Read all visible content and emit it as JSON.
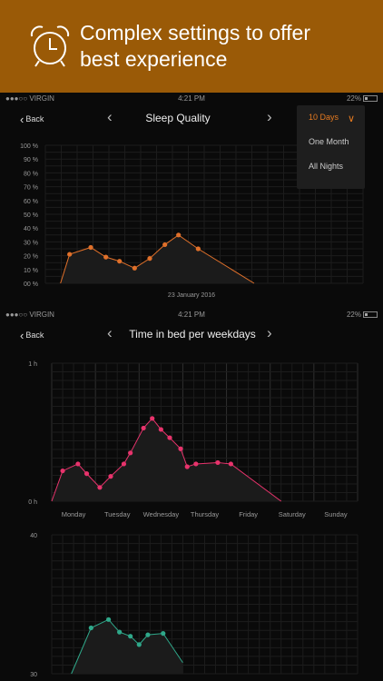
{
  "banner": {
    "line1": "Complex settings to offer",
    "line2": "best experience"
  },
  "status": {
    "carrier": "●●●○○ VIRGIN",
    "time": "4:21 PM",
    "battery": "22%"
  },
  "screen1": {
    "back_label": "Back",
    "title": "Sleep Quality",
    "dropdown": {
      "selected": "10 Days",
      "options": [
        "One Month",
        "All Nights"
      ]
    },
    "chart_data": {
      "type": "area",
      "title": "Sleep Quality",
      "xlabel": "23 January 2016",
      "y_ticks": [
        "100 %",
        "90 %",
        "80 %",
        "70 %",
        "60 %",
        "50 %",
        "40 %",
        "30 %",
        "20 %",
        "10 %",
        "00 %"
      ],
      "ylim": [
        0,
        100
      ],
      "x": [
        1,
        1.6,
        3,
        4,
        4.9,
        5.9,
        6.9,
        7.9,
        8.8,
        10.1,
        13.8
      ],
      "values": [
        0,
        21,
        26,
        19,
        16,
        11,
        18,
        28,
        35,
        25,
        0
      ],
      "xlim": [
        0,
        21
      ],
      "color": "#e0702a",
      "grid": true
    }
  },
  "screen2": {
    "back_label": "Back",
    "title": "Time in bed per weekdays",
    "chart_data": {
      "type": "area",
      "title": "Time in bed per weekdays",
      "categories": [
        "Monday",
        "Tuesday",
        "Wednesday",
        "Thursday",
        "Friday",
        "Saturday",
        "Sunday"
      ],
      "y_ticks": [
        "1 h",
        "0 h"
      ],
      "ylim": [
        0,
        1
      ],
      "x": [
        -0.5,
        -0.25,
        0.1,
        0.3,
        0.6,
        0.85,
        1.15,
        1.3,
        1.6,
        1.8,
        2.0,
        2.2,
        2.45,
        2.6,
        2.8,
        3.3,
        3.6,
        4.75
      ],
      "values": [
        0,
        0.22,
        0.27,
        0.2,
        0.1,
        0.18,
        0.27,
        0.35,
        0.53,
        0.6,
        0.52,
        0.46,
        0.38,
        0.25,
        0.27,
        0.28,
        0.27,
        0
      ],
      "color": "#e8336c",
      "grid": true
    },
    "chart2_data": {
      "type": "area",
      "y_ticks": [
        "40",
        "30"
      ],
      "ylim": [
        30,
        40
      ],
      "x": [
        0.45,
        0.9,
        1.3,
        1.55,
        1.8,
        2.0,
        2.2,
        2.55,
        3.0
      ],
      "values": [
        30,
        33.3,
        33.9,
        33.0,
        32.7,
        32.1,
        32.8,
        32.9,
        30.8
      ],
      "xlim": [
        0,
        7
      ],
      "color": "#2fa88a",
      "grid": true
    }
  }
}
